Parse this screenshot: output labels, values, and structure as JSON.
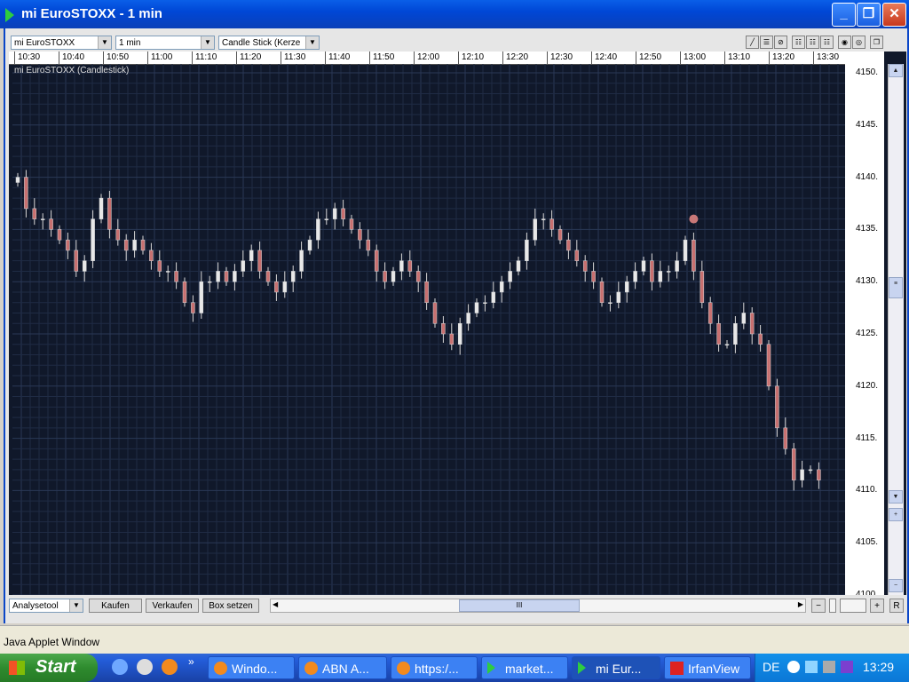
{
  "window": {
    "title": "mi EuroSTOXX - 1 min",
    "minimize": "_",
    "maximize": "❐",
    "close": "✕"
  },
  "toolbar": {
    "instrument": "mi EuroSTOXX",
    "interval": "1 min",
    "chart_type": "Candle Stick (Kerze",
    "tool_icons": [
      "pen-icon",
      "grid-icon",
      "no-grid-icon",
      "layout-icon",
      "layout-icon",
      "layout-icon",
      "zoom-icon",
      "settings-icon",
      "window-icon"
    ]
  },
  "chart": {
    "label": "mi EuroSTOXX (Candlestick)",
    "time_labels": [
      "10:30",
      "10:40",
      "10:50",
      "11:00",
      "11:10",
      "11:20",
      "11:30",
      "11:40",
      "11:50",
      "12:00",
      "12:10",
      "12:20",
      "12:30",
      "12:40",
      "12:50",
      "13:00",
      "13:10",
      "13:20",
      "13:30"
    ],
    "price_labels": [
      "4150.",
      "4145.",
      "4140.",
      "4135.",
      "4130.",
      "4125.",
      "4120.",
      "4115.",
      "4110.",
      "4105.",
      "4100."
    ],
    "colors": {
      "background": "#10182a",
      "grid": "#1f2b44",
      "down": "#c87070",
      "up": "#e8e8e8"
    }
  },
  "chart_data": {
    "type": "candlestick",
    "title": "mi EuroSTOXX (Candlestick)",
    "interval": "1 min",
    "x_range": [
      "10:30",
      "13:30"
    ],
    "ylim": [
      4100,
      4150
    ],
    "grid": true,
    "closes": [
      4140,
      4137,
      4136,
      4136,
      4135,
      4134,
      4133,
      4131,
      4132,
      4136,
      4138,
      4135,
      4134,
      4133,
      4134,
      4133,
      4132,
      4131,
      4131,
      4130,
      4128,
      4127,
      4130,
      4130,
      4131,
      4130,
      4131,
      4132,
      4133,
      4131,
      4130,
      4129,
      4130,
      4131,
      4133,
      4134,
      4136,
      4136,
      4137,
      4136,
      4135,
      4134,
      4133,
      4131,
      4130,
      4131,
      4132,
      4131,
      4130,
      4128,
      4126,
      4125,
      4124,
      4126,
      4127,
      4128,
      4128,
      4129,
      4130,
      4131,
      4132,
      4134,
      4136,
      4136,
      4135,
      4134,
      4133,
      4132,
      4131,
      4130,
      4128,
      4128,
      4129,
      4130,
      4131,
      4132,
      4130,
      4131,
      4131,
      4132,
      4134,
      4131,
      4128,
      4126,
      4124,
      4124,
      4126,
      4127,
      4125,
      4124,
      4120,
      4116,
      4114,
      4111,
      4112,
      4112,
      4111
    ],
    "last_price_marker": 4136
  },
  "bottom_bar": {
    "analysis_tool": "Analysetool",
    "buy": "Kaufen",
    "sell": "Verkaufen",
    "box": "Box setzen",
    "zoom_out": "−",
    "zoom_in": "+",
    "reset": "R",
    "scroll_grip": "III"
  },
  "status": {
    "text": "Java Applet Window"
  },
  "taskbar": {
    "start": "Start",
    "overflow": "»",
    "tasks": [
      "Windo...",
      "ABN A...",
      "https:/...",
      "market...",
      "mi Eur...",
      "IrfanView"
    ],
    "lang": "DE",
    "clock": "13:29"
  }
}
